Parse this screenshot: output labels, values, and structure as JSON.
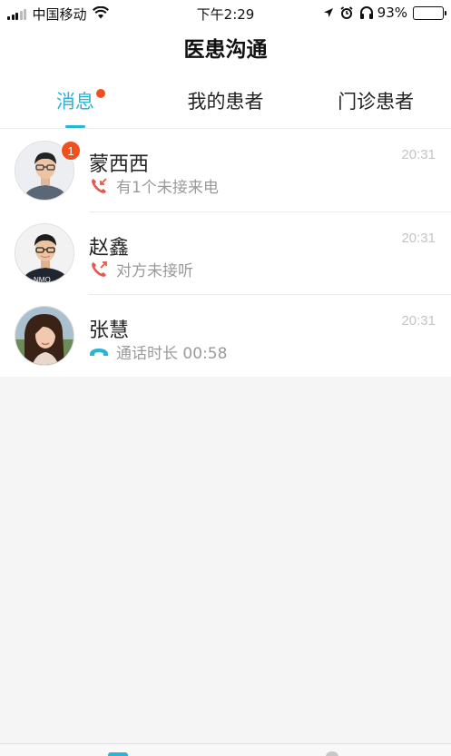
{
  "status_bar": {
    "carrier": "中国移动",
    "time": "下午2:29",
    "battery_percent": "93%",
    "battery_level": 0.93
  },
  "nav": {
    "title": "医患沟通"
  },
  "tabs": [
    {
      "label": "消息",
      "active": true,
      "has_dot": true
    },
    {
      "label": "我的患者",
      "active": false
    },
    {
      "label": "门诊患者",
      "active": false
    }
  ],
  "messages": [
    {
      "name": "蒙西西",
      "status": "有1个未接来电",
      "time": "20:31",
      "badge": "1",
      "call_icon": "missed-call-icon",
      "icon_color": "#e8574a"
    },
    {
      "name": "赵鑫",
      "status": "对方未接听",
      "time": "20:31",
      "badge": "",
      "call_icon": "outgoing-call-icon",
      "icon_color": "#e8574a"
    },
    {
      "name": "张慧",
      "status": "通话时长 00:58",
      "time": "20:31",
      "badge": "",
      "call_icon": "call-ended-icon",
      "icon_color": "#2ab4d8"
    }
  ],
  "colors": {
    "accent": "#2ab4d8",
    "badge": "#f0501e",
    "missed_call": "#e8574a"
  }
}
